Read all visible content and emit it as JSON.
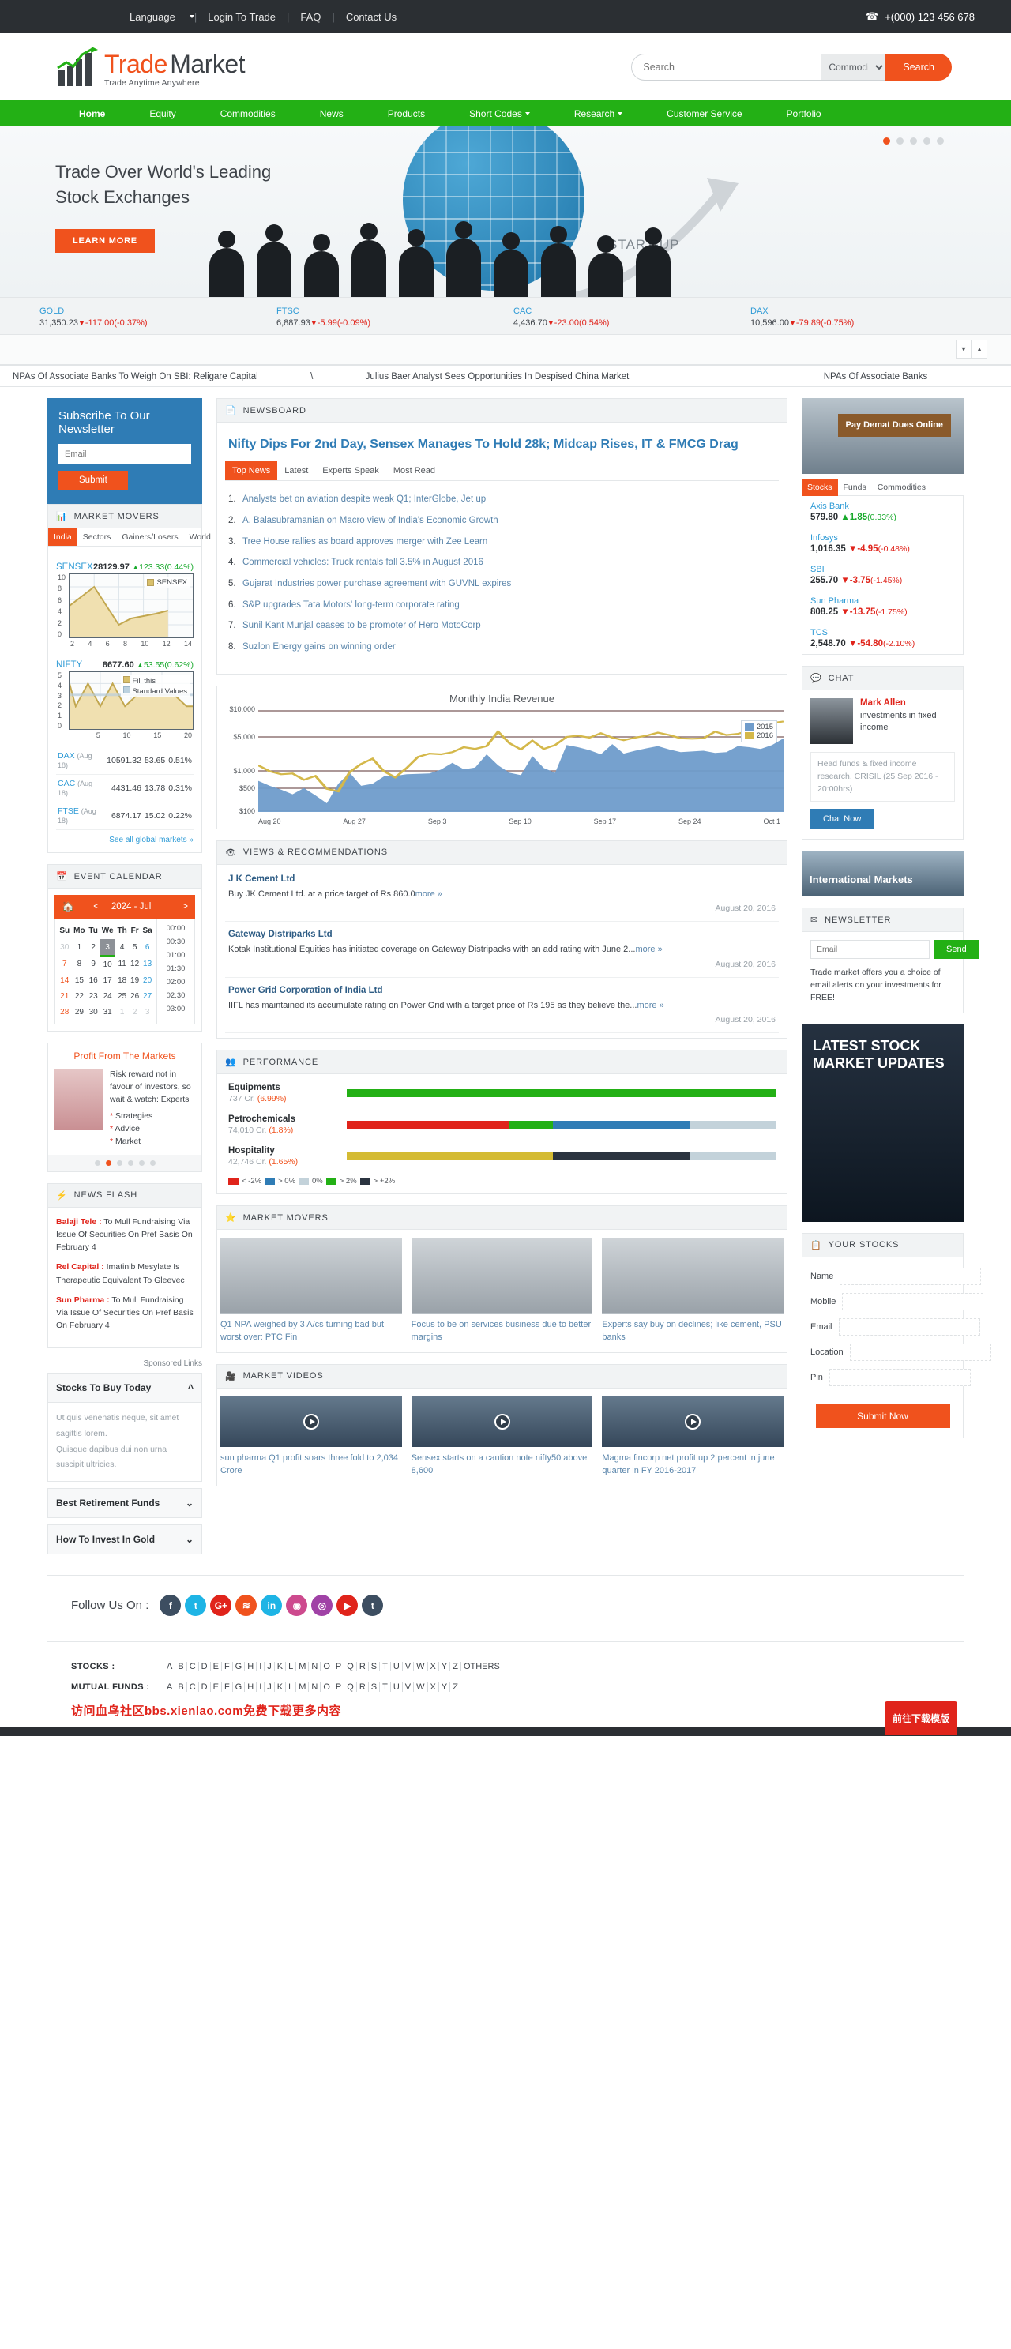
{
  "topbar": {
    "language": "Language",
    "login": "Login To Trade",
    "faq": "FAQ",
    "contact": "Contact Us",
    "phone": "+(000) 123 456 678",
    "phone_icon": "phone-icon"
  },
  "brand": {
    "name1": "Trade",
    "name2": "Market",
    "tagline": "Trade Anytime Anywhere"
  },
  "search": {
    "placeholder": "Search",
    "category": "Commodities",
    "button": "Search"
  },
  "nav": [
    {
      "label": "Home",
      "active": true,
      "caret": false
    },
    {
      "label": "Equity",
      "active": false,
      "caret": false
    },
    {
      "label": "Commodities",
      "active": false,
      "caret": false
    },
    {
      "label": "News",
      "active": false,
      "caret": false
    },
    {
      "label": "Products",
      "active": false,
      "caret": false
    },
    {
      "label": "Short Codes",
      "active": false,
      "caret": true
    },
    {
      "label": "Research",
      "active": false,
      "caret": true
    },
    {
      "label": "Customer Service",
      "active": false,
      "caret": false
    },
    {
      "label": "Portfolio",
      "active": false,
      "caret": false
    }
  ],
  "hero": {
    "title": "Trade Over World's Leading Stock Exchanges",
    "cta": "LEARN MORE",
    "startup": "START-UP"
  },
  "indices": [
    {
      "name": "GOLD",
      "value": "31,350.23",
      "change": "-117.00(-0.37%)",
      "dir": "down"
    },
    {
      "name": "FTSC",
      "value": "6,887.93",
      "change": "-5.99(-0.09%)",
      "dir": "down"
    },
    {
      "name": "CAC",
      "value": "4,436.70",
      "change": "-23.00(0.54%)",
      "dir": "down"
    },
    {
      "name": "DAX",
      "value": "10,596.00",
      "change": "-79.89(-0.75%)",
      "dir": "down"
    }
  ],
  "ticker": {
    "item1": "NPAs Of Associate Banks To Weigh On SBI: Religare Capital",
    "sep": "\\",
    "item2": "Julius Baer Analyst Sees Opportunities In Despised China Market",
    "item3": "NPAs Of Associate Banks"
  },
  "newsletter": {
    "title": "Subscribe To Our Newsletter",
    "placeholder": "Email",
    "button": "Submit"
  },
  "market_movers_left": {
    "header": "MARKET MOVERS",
    "header_icon": "bar-chart-icon",
    "tabs": [
      "India",
      "Sectors",
      "Gainers/Losers",
      "World"
    ],
    "active_tab": "India",
    "sensex": {
      "name": "SENSEX",
      "value": "28129.97",
      "change": "123.33(0.44%)",
      "legend": "SENSEX"
    },
    "nifty": {
      "name": "NIFTY",
      "value": "8677.60",
      "change": "53.55(0.62%)",
      "legend1": "Fill this",
      "legend2": "Standard Values"
    },
    "table": [
      {
        "name": "DAX",
        "date": "(Aug 18)",
        "value": "10591.32",
        "chg": "53.65",
        "pct": "0.51%"
      },
      {
        "name": "CAC",
        "date": "(Aug 18)",
        "value": "4431.46",
        "chg": "13.78",
        "pct": "0.31%"
      },
      {
        "name": "FTSE",
        "date": "(Aug 18)",
        "value": "6874.17",
        "chg": "15.02",
        "pct": "0.22%"
      }
    ],
    "see_all": "See all global markets »"
  },
  "chart_data": [
    {
      "type": "area",
      "title": "SENSEX",
      "x": [
        2,
        3,
        4,
        5,
        6,
        7,
        8,
        9,
        10,
        10.6
      ],
      "values": [
        5,
        6.5,
        8,
        5,
        2,
        3,
        3.3,
        3.7,
        4,
        4.3
      ],
      "xlabel": "",
      "ylabel": "",
      "ylim": [
        0,
        10
      ],
      "xlim": [
        2,
        14
      ],
      "xticks": [
        2,
        4,
        6,
        8,
        10,
        12,
        14
      ],
      "yticks": [
        0,
        2,
        4,
        6,
        8,
        10
      ],
      "legend": [
        "SENSEX"
      ],
      "legend_position": "top-right",
      "grid": true
    },
    {
      "type": "area",
      "title": "NIFTY",
      "x": [
        1,
        2,
        3,
        4,
        5,
        6,
        7,
        8,
        9,
        10,
        11,
        12,
        13,
        14,
        15,
        16,
        17,
        18,
        19,
        20
      ],
      "series": [
        {
          "name": "Fill this",
          "values": [
            4,
            2,
            3,
            4,
            3,
            2,
            3,
            4,
            3,
            2,
            2.5,
            3,
            3,
            3,
            3,
            3,
            3,
            3,
            2.5,
            2
          ]
        },
        {
          "name": "Standard Values",
          "values": [
            3,
            3,
            3,
            3,
            3,
            3,
            3,
            3,
            3,
            3,
            3,
            3,
            3,
            3,
            3,
            3,
            3,
            3,
            3,
            3
          ]
        }
      ],
      "xlabel": "",
      "ylabel": "",
      "ylim": [
        0,
        5
      ],
      "xlim": [
        1,
        20
      ],
      "xticks": [
        5,
        10,
        15,
        20
      ],
      "yticks": [
        0,
        1,
        2,
        3,
        4,
        5
      ],
      "legend": [
        "Fill this",
        "Standard Values"
      ],
      "legend_position": "top-right",
      "grid": true
    },
    {
      "type": "area",
      "title": "Monthly India Revenue",
      "xlabel": "",
      "ylabel": "",
      "xticks": [
        "Aug 20",
        "Aug 27",
        "Sep 3",
        "Sep 10",
        "Sep 17",
        "Sep 24",
        "Oct 1"
      ],
      "yticks": [
        "$100",
        "$500",
        "$1,000",
        "$5,000",
        "$10,000"
      ],
      "ylim": [
        100,
        10000
      ],
      "log_scale": true,
      "grid": true,
      "legend": [
        "2015",
        "2016"
      ],
      "legend_position": "top-right",
      "series": [
        {
          "name": "2015",
          "color": "#6699cc",
          "values": [
            380,
            300,
            250,
            200,
            270,
            190,
            130,
            330,
            560,
            300,
            330,
            470,
            480,
            520,
            530,
            540,
            650,
            900,
            660,
            720,
            1350,
            800,
            560,
            500,
            1250,
            700,
            560,
            2100,
            1900,
            1650,
            1350,
            2200,
            1400,
            1600,
            1800,
            2000,
            1700,
            1500,
            1550,
            1600,
            1450,
            1500,
            2000,
            1900,
            1750,
            2100,
            2900
          ]
        },
        {
          "name": "2016",
          "color": "#d4b84a",
          "values": [
            800,
            600,
            520,
            540,
            400,
            480,
            260,
            230,
            580,
            850,
            1100,
            600,
            450,
            700,
            1200,
            1400,
            1350,
            1500,
            1900,
            1750,
            2000,
            4000,
            2300,
            1700,
            2600,
            1750,
            2100,
            3100,
            3300,
            3000,
            3700,
            3000,
            2650,
            3000,
            3300,
            3800,
            3400,
            2900,
            2850,
            2900,
            4000,
            3400,
            3600,
            4200,
            5000,
            6000,
            6500
          ]
        }
      ]
    },
    {
      "type": "bar",
      "title": "PERFORMANCE",
      "categories": [
        "Equipments",
        "Petrochemicals",
        "Hospitality"
      ],
      "sublabels": [
        "737 Cr. (6.99%)",
        "74,010 Cr. (1.8%)",
        "42,746 Cr. (1.65%)"
      ],
      "segments": [
        [
          {
            "color": "#23b015",
            "pct": 100
          }
        ],
        [
          {
            "color": "#e0241b",
            "pct": 38
          },
          {
            "color": "#23b015",
            "pct": 10
          },
          {
            "color": "#2f7cb5",
            "pct": 32
          },
          {
            "color": "#c3d2da",
            "pct": 20
          }
        ],
        [
          {
            "color": "#d4bb33",
            "pct": 48
          },
          {
            "color": "#2b3440",
            "pct": 32
          },
          {
            "color": "#c3d2da",
            "pct": 20
          }
        ]
      ],
      "legend": [
        {
          "label": "< -2%",
          "color": "#e0241b"
        },
        {
          "label": "> 0%",
          "color": "#2f7cb5"
        },
        {
          "label": "0%",
          "color": "#c3d2da"
        },
        {
          "label": "> 2%",
          "color": "#23b015"
        },
        {
          "label": "> +2%",
          "color": "#2b3440"
        }
      ]
    }
  ],
  "calendar": {
    "header": "EVENT CALENDAR",
    "header_icon": "calendar-icon",
    "home_icon": "home-icon",
    "prev": "<",
    "next": ">",
    "title": "2024 - Jul",
    "daynames": [
      "Su",
      "Mo",
      "Tu",
      "We",
      "Th",
      "Fr",
      "Sa"
    ],
    "weeks": [
      [
        {
          "d": "30",
          "t": "mut"
        },
        {
          "d": "1"
        },
        {
          "d": "2"
        },
        {
          "d": "3",
          "t": "sel"
        },
        {
          "d": "4"
        },
        {
          "d": "5"
        },
        {
          "d": "6",
          "t": "sat"
        }
      ],
      [
        {
          "d": "7",
          "t": "sun"
        },
        {
          "d": "8"
        },
        {
          "d": "9"
        },
        {
          "d": "10"
        },
        {
          "d": "11"
        },
        {
          "d": "12"
        },
        {
          "d": "13",
          "t": "sat"
        }
      ],
      [
        {
          "d": "14",
          "t": "sun"
        },
        {
          "d": "15"
        },
        {
          "d": "16"
        },
        {
          "d": "17"
        },
        {
          "d": "18"
        },
        {
          "d": "19"
        },
        {
          "d": "20",
          "t": "sat"
        }
      ],
      [
        {
          "d": "21",
          "t": "sun"
        },
        {
          "d": "22"
        },
        {
          "d": "23"
        },
        {
          "d": "24"
        },
        {
          "d": "25"
        },
        {
          "d": "26"
        },
        {
          "d": "27",
          "t": "sat"
        }
      ],
      [
        {
          "d": "28",
          "t": "sun"
        },
        {
          "d": "29"
        },
        {
          "d": "30"
        },
        {
          "d": "31"
        },
        {
          "d": "1",
          "t": "mut"
        },
        {
          "d": "2",
          "t": "mut"
        },
        {
          "d": "3",
          "t": "mut"
        }
      ]
    ],
    "times": [
      "00:00",
      "00:30",
      "01:00",
      "01:30",
      "02:00",
      "02:30",
      "03:00"
    ]
  },
  "promo": {
    "title": "Profit From The Markets",
    "text": "Risk reward not in favour of investors, so wait & watch: Experts",
    "bullets": [
      "Strategies",
      "Advice",
      "Market"
    ]
  },
  "news_flash": {
    "header": "NEWS FLASH",
    "header_icon": "bolt-icon",
    "items": [
      {
        "tag": "Balaji Tele :",
        "text": "To Mull Fundraising Via Issue Of Securities On Pref Basis On February 4"
      },
      {
        "tag": "Rel Capital :",
        "text": "Imatinib Mesylate Is Therapeutic Equivalent To Gleevec"
      },
      {
        "tag": "Sun Pharma :",
        "text": "To Mull Fundraising Via Issue Of Securities On Pref Basis On February 4"
      }
    ]
  },
  "sponsored": {
    "label": "Sponsored Links",
    "items": [
      {
        "title": "Stocks To Buy Today",
        "open": true,
        "body": [
          "Ut quis venenatis neque, sit amet sagittis lorem.",
          "Quisque dapibus dui non urna suscipit ultricies."
        ]
      },
      {
        "title": "Best Retirement Funds",
        "open": false
      },
      {
        "title": "How To Invest In Gold",
        "open": false
      }
    ]
  },
  "newsboard": {
    "header": "NEWSBOARD",
    "header_icon": "document-icon",
    "title": "Nifty Dips For 2nd Day, Sensex Manages To Hold 28k; Midcap Rises, IT & FMCG Drag",
    "tabs": [
      "Top News",
      "Latest",
      "Experts Speak",
      "Most Read"
    ],
    "active_tab": "Top News",
    "items": [
      "Analysts bet on aviation despite weak Q1; InterGlobe, Jet up",
      "A. Balasubramanian on Macro view of India's Economic Growth",
      "Tree House rallies as board approves merger with Zee Learn",
      "Commercial vehicles: Truck rentals fall 3.5% in August 2016",
      "Gujarat Industries power purchase agreement with GUVNL expires",
      "S&P upgrades Tata Motors' long-term corporate rating",
      "Sunil Kant Munjal ceases to be promoter of Hero MotoCorp",
      "Suzlon Energy gains on winning order"
    ]
  },
  "views": {
    "header": "VIEWS & RECOMMENDATIONS",
    "header_icon": "eye-icon",
    "items": [
      {
        "title": "J K Cement Ltd",
        "text": "Buy JK Cement Ltd. at a price target of Rs 860.0",
        "more": "more »",
        "date": "August 20, 2016"
      },
      {
        "title": "Gateway Distriparks Ltd",
        "text": "Kotak Institutional Equities has initiated coverage on Gateway Distripacks with an add rating with June 2...",
        "more": "more »",
        "date": "August 20, 2016"
      },
      {
        "title": "Power Grid Corporation of India Ltd",
        "text": "IIFL has maintained its accumulate rating on Power Grid with a target price of Rs 195 as they believe the...",
        "more": "more »",
        "date": "August 20, 2016"
      }
    ]
  },
  "performance": {
    "header": "PERFORMANCE",
    "header_icon": "group-icon"
  },
  "movers_center": {
    "header": "MARKET MOVERS",
    "header_icon": "star-icon",
    "cards": [
      "Q1 NPA weighed by 3 A/cs turning bad but worst over: PTC Fin",
      "Focus to be on services business due to better margins",
      "Experts say buy on declines; like cement, PSU banks"
    ]
  },
  "videos": {
    "header": "MARKET VIDEOS",
    "header_icon": "video-icon",
    "cards": [
      "sun pharma Q1 profit soars three fold to 2,034 Crore",
      "Sensex starts on a caution note nifty50 above 8,600",
      "Magma fincorp net profit up 2 percent in june quarter in FY 2016-2017"
    ]
  },
  "right": {
    "ad_text": "Pay Demat Dues Online",
    "tabs": [
      "Stocks",
      "Funds",
      "Commodities"
    ],
    "active_tab": "Stocks",
    "stocks": [
      {
        "name": "Axis Bank",
        "price": "579.80",
        "chg": "1.85",
        "pct": "(0.33%)",
        "dir": "up"
      },
      {
        "name": "Infosys",
        "price": "1,016.35",
        "chg": "-4.95",
        "pct": "(-0.48%)",
        "dir": "down"
      },
      {
        "name": "SBI",
        "price": "255.70",
        "chg": "-3.75",
        "pct": "(-1.45%)",
        "dir": "down"
      },
      {
        "name": "Sun Pharma",
        "price": "808.25",
        "chg": "-13.75",
        "pct": "(-1.75%)",
        "dir": "down"
      },
      {
        "name": "TCS",
        "price": "2,548.70",
        "chg": "-54.80",
        "pct": "(-2.10%)",
        "dir": "down"
      }
    ],
    "chat": {
      "header": "CHAT",
      "header_icon": "chat-icon",
      "name": "Mark Allen",
      "desc": "investments in fixed income",
      "quote": "Head funds & fixed income research, CRISIL",
      "time": "(25 Sep 2016 - 20:00hrs)",
      "button": "Chat Now"
    },
    "intl_banner": "International Markets",
    "newsletter": {
      "header": "NEWSLETTER",
      "header_icon": "envelope-icon",
      "placeholder": "Email",
      "button": "Send",
      "note": "Trade market offers you a choice of email alerts on your investments for FREE!"
    },
    "big_ad": "LATEST STOCK MARKET UPDATES",
    "your_stocks": {
      "header": "YOUR STOCKS",
      "header_icon": "list-icon",
      "fields": [
        "Name",
        "Mobile",
        "Email",
        "Location",
        "Pin"
      ],
      "button": "Submit Now"
    }
  },
  "footer": {
    "follow_label": "Follow Us On :",
    "socials": [
      {
        "name": "facebook-icon",
        "glyph": "f",
        "color": "#3d4e61"
      },
      {
        "name": "twitter-icon",
        "glyph": "t",
        "color": "#1eb4e5"
      },
      {
        "name": "google-plus-icon",
        "glyph": "G+",
        "color": "#e0241b"
      },
      {
        "name": "rss-icon",
        "glyph": "≋",
        "color": "#f0521d"
      },
      {
        "name": "linkedin-icon",
        "glyph": "in",
        "color": "#1eb4e5"
      },
      {
        "name": "dribbble-icon",
        "glyph": "◉",
        "color": "#cd4a8e"
      },
      {
        "name": "instagram-icon",
        "glyph": "◎",
        "color": "#a042a6"
      },
      {
        "name": "youtube-icon",
        "glyph": "▶",
        "color": "#e0241b"
      },
      {
        "name": "tumblr-icon",
        "glyph": "t",
        "color": "#3d4e61"
      }
    ],
    "stocks_label": "STOCKS :",
    "stocks_letters": [
      "A",
      "B",
      "C",
      "D",
      "E",
      "F",
      "G",
      "H",
      "I",
      "J",
      "K",
      "L",
      "M",
      "N",
      "O",
      "P",
      "Q",
      "R",
      "S",
      "T",
      "U",
      "V",
      "W",
      "X",
      "Y",
      "Z",
      "OTHERS"
    ],
    "funds_label": "MUTUAL FUNDS :",
    "funds_letters": [
      "A",
      "B",
      "C",
      "D",
      "E",
      "F",
      "G",
      "H",
      "I",
      "J",
      "K",
      "L",
      "M",
      "N",
      "O",
      "P",
      "Q",
      "R",
      "S",
      "T",
      "U",
      "V",
      "W",
      "X",
      "Y",
      "Z"
    ],
    "watermark": "访问血鸟社区bbs.xienlao.com免费下载更多内容",
    "float_button": "前往下载模版"
  }
}
